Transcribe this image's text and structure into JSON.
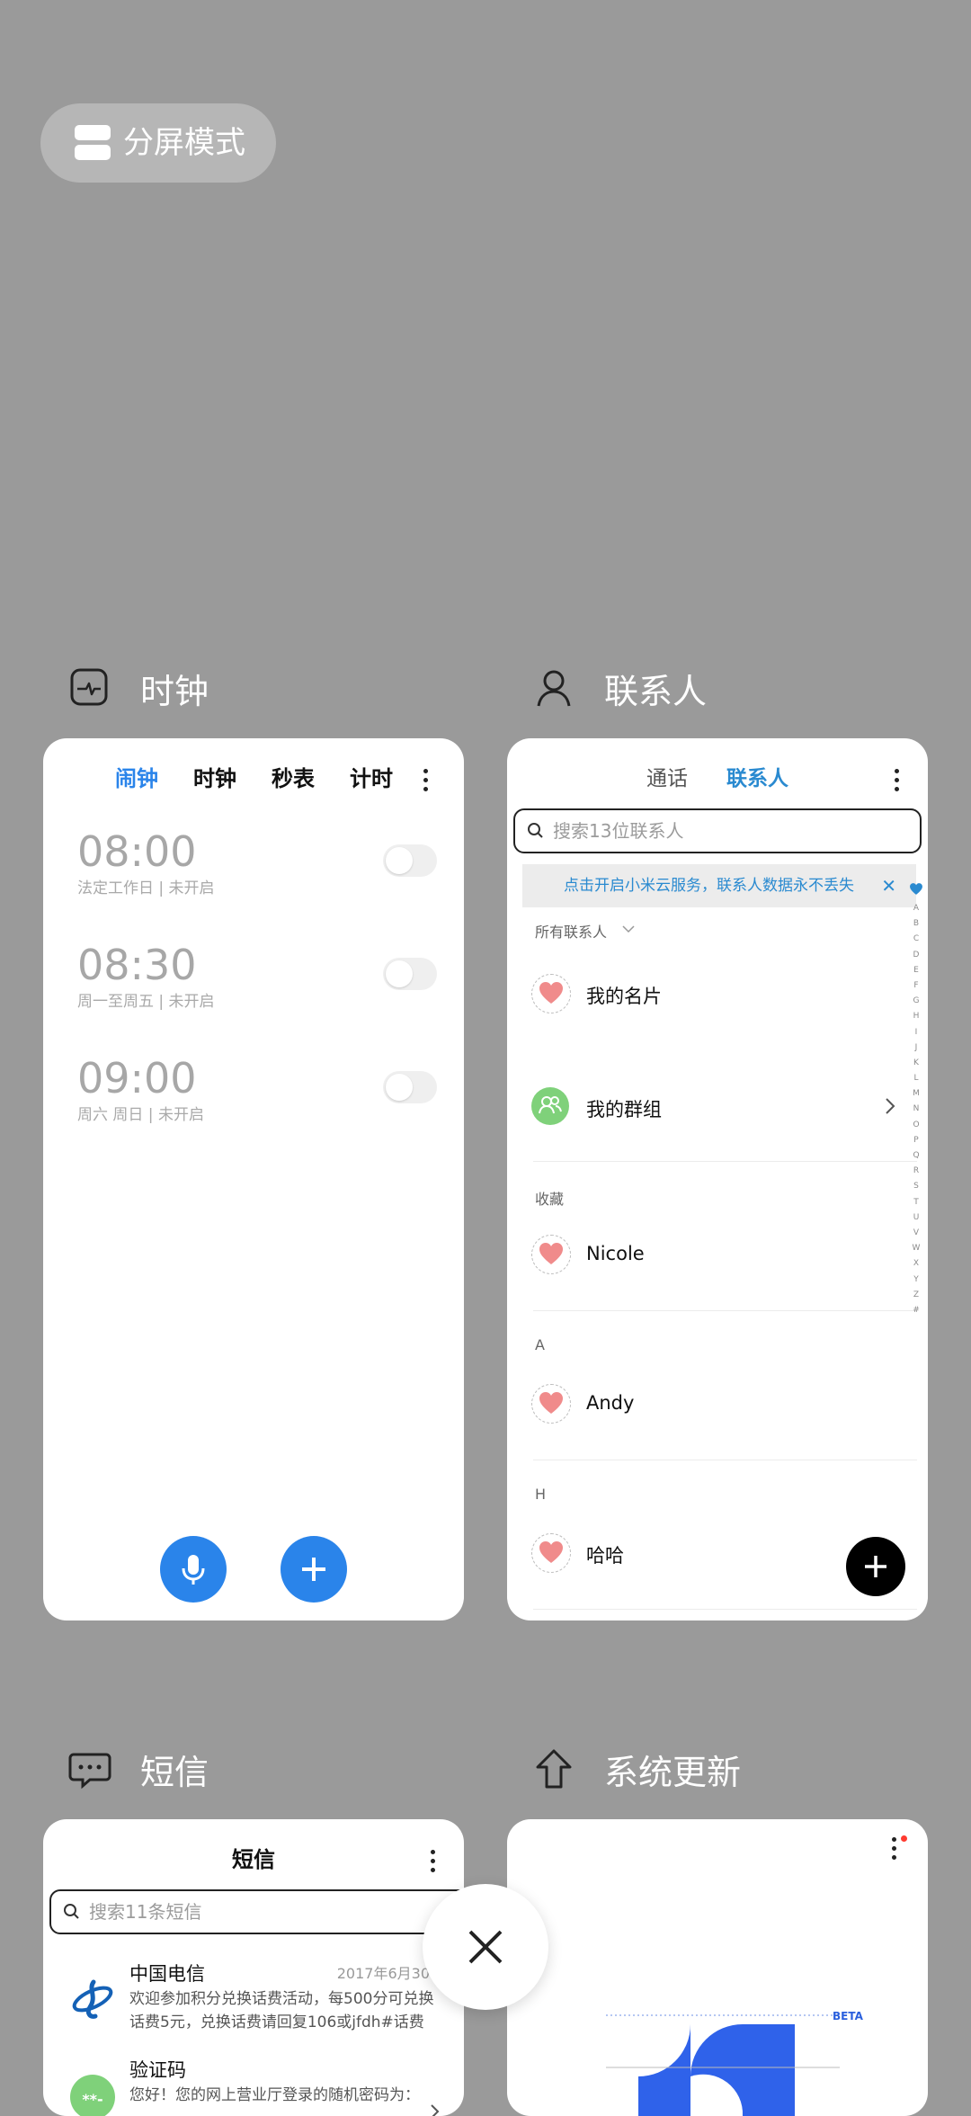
{
  "split_screen": {
    "label": "分屏模式",
    "icon": "split-screen-icon"
  },
  "apps": {
    "clock": {
      "title": "时钟",
      "icon": "clock-app-icon",
      "tabs": [
        "闹钟",
        "时钟",
        "秒表",
        "计时"
      ],
      "active_tab": 0,
      "alarms": [
        {
          "time": "08:00",
          "detail": "法定工作日 | 未开启",
          "enabled": false
        },
        {
          "time": "08:30",
          "detail": "周一至周五 | 未开启",
          "enabled": false
        },
        {
          "time": "09:00",
          "detail": "周六 周日 | 未开启",
          "enabled": false
        }
      ]
    },
    "contacts": {
      "title": "联系人",
      "icon": "contacts-app-icon",
      "tabs": [
        "通话",
        "联系人"
      ],
      "active_tab": 1,
      "search_placeholder": "搜索13位联系人",
      "banner_text": "点击开启小米云服务，联系人数据永不丢失",
      "all_contacts_label": "所有联系人",
      "my_card": "我的名片",
      "my_groups": "我的群组",
      "favorites_label": "收藏",
      "favorite_contact": "Nicole",
      "section_a": "A",
      "contact_a": "Andy",
      "section_h": "H",
      "contact_h": "哈哈",
      "alphabet": [
        "A",
        "B",
        "C",
        "D",
        "E",
        "F",
        "G",
        "H",
        "I",
        "J",
        "K",
        "L",
        "M",
        "N",
        "O",
        "P",
        "Q",
        "R",
        "S",
        "T",
        "U",
        "V",
        "W",
        "X",
        "Y",
        "Z",
        "#"
      ]
    },
    "messages": {
      "title": "短信",
      "header_title": "短信",
      "icon": "messages-app-icon",
      "search_placeholder": "搜索11条短信",
      "threads": [
        {
          "sender": "中国电信",
          "time": "2017年6月30日",
          "preview": "欢迎参加积分兑换话费活动，每500分可兑换话费5元，兑换话费请回复106或jfdh#话费金…"
        },
        {
          "sender": "验证码",
          "time": "",
          "preview": "您好！您的网上营业厅登录的随机密码为："
        }
      ]
    },
    "system_update": {
      "title": "系统更新",
      "icon": "system-update-app-icon",
      "beta_label": "BETA"
    }
  },
  "colors": {
    "background": "#9a9a9a",
    "accent_blue": "#2a84ea",
    "link_blue": "#2a8ad0",
    "heart_pink": "#f08b8b",
    "group_green": "#7fd17a"
  }
}
